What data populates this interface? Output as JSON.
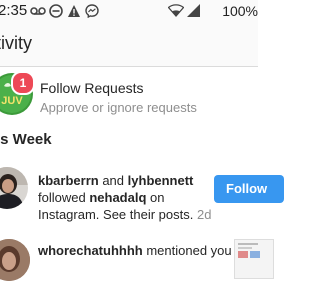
{
  "status_bar": {
    "time": "2:35",
    "battery_percent": "100%",
    "icons": [
      "voicemail-icon",
      "no-disturb-icon",
      "alert-icon",
      "messenger-icon",
      "wifi-icon",
      "signal-icon"
    ]
  },
  "header": {
    "title": "tivity"
  },
  "follow_requests": {
    "badge_count": "1",
    "title": "Follow Requests",
    "subtitle": "Approve or ignore requests"
  },
  "section": {
    "title": "is Week"
  },
  "activities": [
    {
      "user1": "kbarberrn",
      "connector": "and",
      "user2": "lyhbennett",
      "action": "followed",
      "target": "nehadalq",
      "on": "on",
      "rest": "Instagram. See their posts.",
      "time": "2d",
      "button": "Follow"
    },
    {
      "user": "whorechatuhhhh",
      "action": "mentioned you"
    }
  ],
  "colors": {
    "accent": "#3897f0",
    "badge": "#ed4956",
    "muted": "#8e8e8e"
  }
}
